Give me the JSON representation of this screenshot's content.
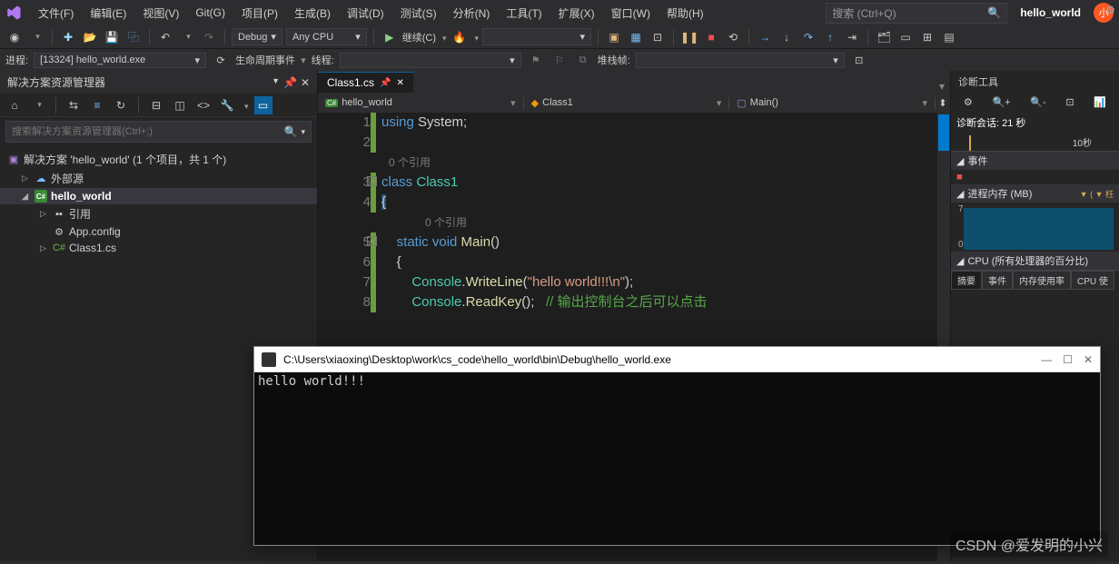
{
  "menu": [
    "文件(F)",
    "编辑(E)",
    "视图(V)",
    "Git(G)",
    "项目(P)",
    "生成(B)",
    "调试(D)",
    "测试(S)",
    "分析(N)",
    "工具(T)",
    "扩展(X)",
    "窗口(W)",
    "帮助(H)"
  ],
  "search_placeholder": "搜索 (Ctrl+Q)",
  "project_name": "hello_world",
  "user_initial": "小",
  "toolbar": {
    "config": "Debug",
    "platform": "Any CPU",
    "continue": "继续(C)"
  },
  "debugbar": {
    "process_label": "进程:",
    "process": "[13324] hello_world.exe",
    "lifecycle": "生命周期事件",
    "thread": "线程:",
    "stackframe": "堆栈帧:"
  },
  "solution_explorer": {
    "title": "解决方案资源管理器",
    "search": "搜索解决方案资源管理器(Ctrl+;)",
    "solution": "解决方案 'hello_world' (1 个项目，共 1 个)",
    "items": {
      "external": "外部源",
      "project": "hello_world",
      "references": "引用",
      "appconfig": "App.config",
      "class1": "Class1.cs"
    }
  },
  "tab": {
    "name": "Class1.cs"
  },
  "breadcrumb": {
    "proj": "hello_world",
    "cls": "Class1",
    "method": "Main()"
  },
  "code": {
    "ref0": "0 个引用",
    "ref1": "0 个引用",
    "lines": [
      "1",
      "2",
      "",
      "3",
      "4",
      "",
      "5",
      "6",
      "7",
      "8"
    ],
    "l1_using": "using",
    "l1_system": " System;",
    "l3_class": "class",
    "l3_name": " Class1",
    "l4_brace": "{",
    "l5_static": "static",
    "l5_void": " void",
    "l5_main": " Main",
    "l5_paren": "()",
    "l6_brace": "{",
    "l7_console": "Console",
    "l7_dot": ".",
    "l7_wl": "WriteLine",
    "l7_open": "(",
    "l7_str": "\"hello world!!!\\n\"",
    "l7_close": ");",
    "l8_console": "Console",
    "l8_rk": "ReadKey",
    "l8_paren": "();",
    "l8_cmt": "   // 输出控制台之后可以点击"
  },
  "diag": {
    "title": "诊断工具",
    "session": "诊断会话: 21 秒",
    "time_tick": "10秒",
    "events": "事件",
    "events_stop": "■",
    "mem_title": "进程内存 (MB)",
    "mem_badge": "▼ ( ▼ 枉",
    "mem_max": "7",
    "mem_min": "0",
    "cpu_title": "CPU (所有处理器的百分比)",
    "tabs": [
      "摘要",
      "事件",
      "内存使用率",
      "CPU 使"
    ]
  },
  "console": {
    "path": "C:\\Users\\xiaoxing\\Desktop\\work\\cs_code\\hello_world\\bin\\Debug\\hello_world.exe",
    "output": "hello world!!!"
  },
  "watermark": "CSDN @爱发明的小兴"
}
